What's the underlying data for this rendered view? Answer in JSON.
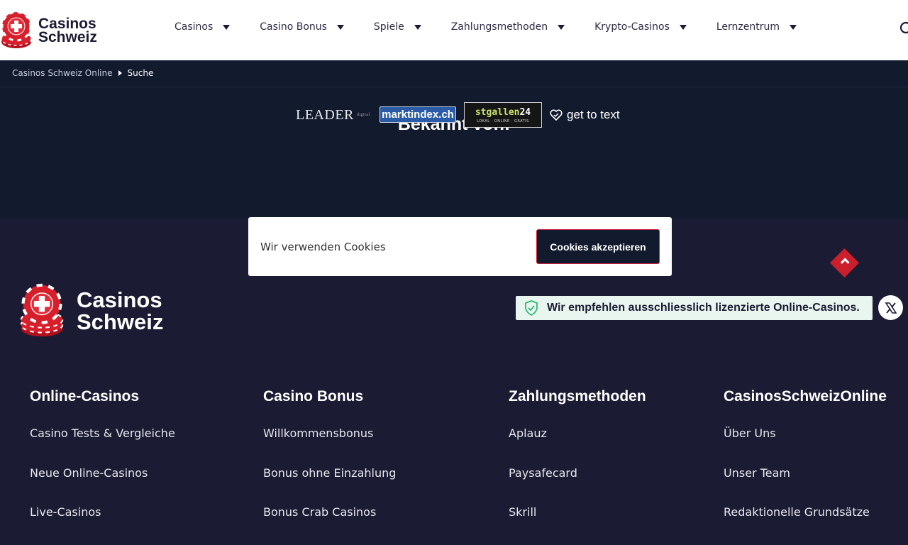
{
  "header": {
    "logo_line1": "Casinos",
    "logo_line2": "Schweiz",
    "nav": [
      {
        "label": "Casinos"
      },
      {
        "label": "Casino Bonus"
      },
      {
        "label": "Spiele"
      },
      {
        "label": "Zahlungsmethoden"
      },
      {
        "label": "Krypto-Casinos"
      },
      {
        "label": "Lernzentrum"
      }
    ],
    "search_icon": "search-icon"
  },
  "breadcrumb": {
    "home": "Casinos Schweiz Online",
    "current": "Suche"
  },
  "known": {
    "title": "Bekannt von:",
    "logos": {
      "leader": "LEADER",
      "leader_small": "digital",
      "marktindex": "marktindex.ch",
      "stgallen_a": "stgallen",
      "stgallen_b": "24",
      "stgallen_sub": "LOKAL · ONLINE · GRATIS",
      "gettotext": "get to text"
    }
  },
  "cookie": {
    "text": "Wir verwenden Cookies",
    "button": "Cookies akzeptieren"
  },
  "footer": {
    "logo_line1": "Casinos",
    "logo_line2": "Schweiz",
    "license_text": "Wir empfehlen ausschliesslich lizenzierte Online-Casinos.",
    "columns": [
      {
        "title": "Online-Casinos",
        "links": [
          "Casino Tests & Vergleiche",
          "Neue Online-Casinos",
          "Live-Casinos"
        ]
      },
      {
        "title": "Casino Bonus",
        "links": [
          "Willkommensbonus",
          "Bonus ohne Einzahlung",
          "Bonus Crab Casinos"
        ]
      },
      {
        "title": "Zahlungsmethoden",
        "links": [
          "Aplauz",
          "Paysafecard",
          "Skrill"
        ]
      },
      {
        "title": "CasinosSchweizOnline",
        "links": [
          "Über Uns",
          "Unser Team",
          "Redaktionelle Grundsätze"
        ]
      }
    ]
  },
  "colors": {
    "accent": "#cc1f2c",
    "dark_navy": "#121a2e",
    "footer_bg": "#1b1b33"
  }
}
